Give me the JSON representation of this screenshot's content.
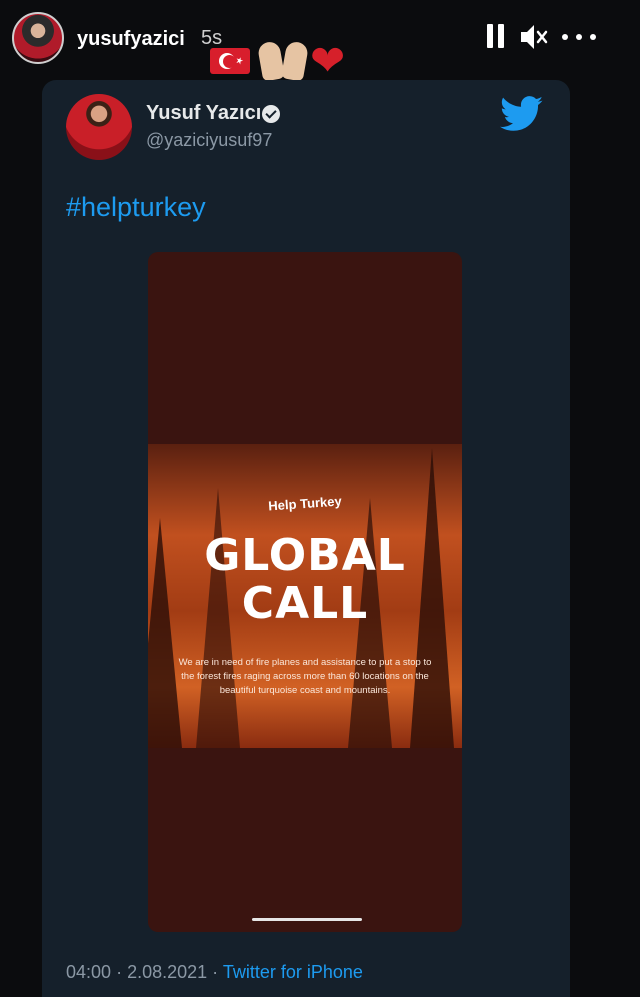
{
  "story": {
    "username": "yusufyazici",
    "time": "5s",
    "emojis": [
      "turkey-flag",
      "praying-hands",
      "red-heart"
    ],
    "heart_glyph": "❤"
  },
  "tweet": {
    "display_name": "Yusuf Yazıcı",
    "handle": "@yaziciyusuf97",
    "text": "#helpturkey",
    "media": {
      "subtitle": "Help Turkey",
      "title_line1": "GLOBAL",
      "title_line2": "CALL",
      "body": "We are in need of fire planes and assistance to put a stop to the forest fires raging across more than 60 locations on the beautiful turquoise coast and mountains."
    },
    "time": "04:00",
    "separator": "·",
    "date": "2.08.2021",
    "source": "Twitter for iPhone"
  },
  "colors": {
    "card_bg": "#15202b",
    "accent": "#1d9bf0",
    "heart": "#d6202a"
  }
}
